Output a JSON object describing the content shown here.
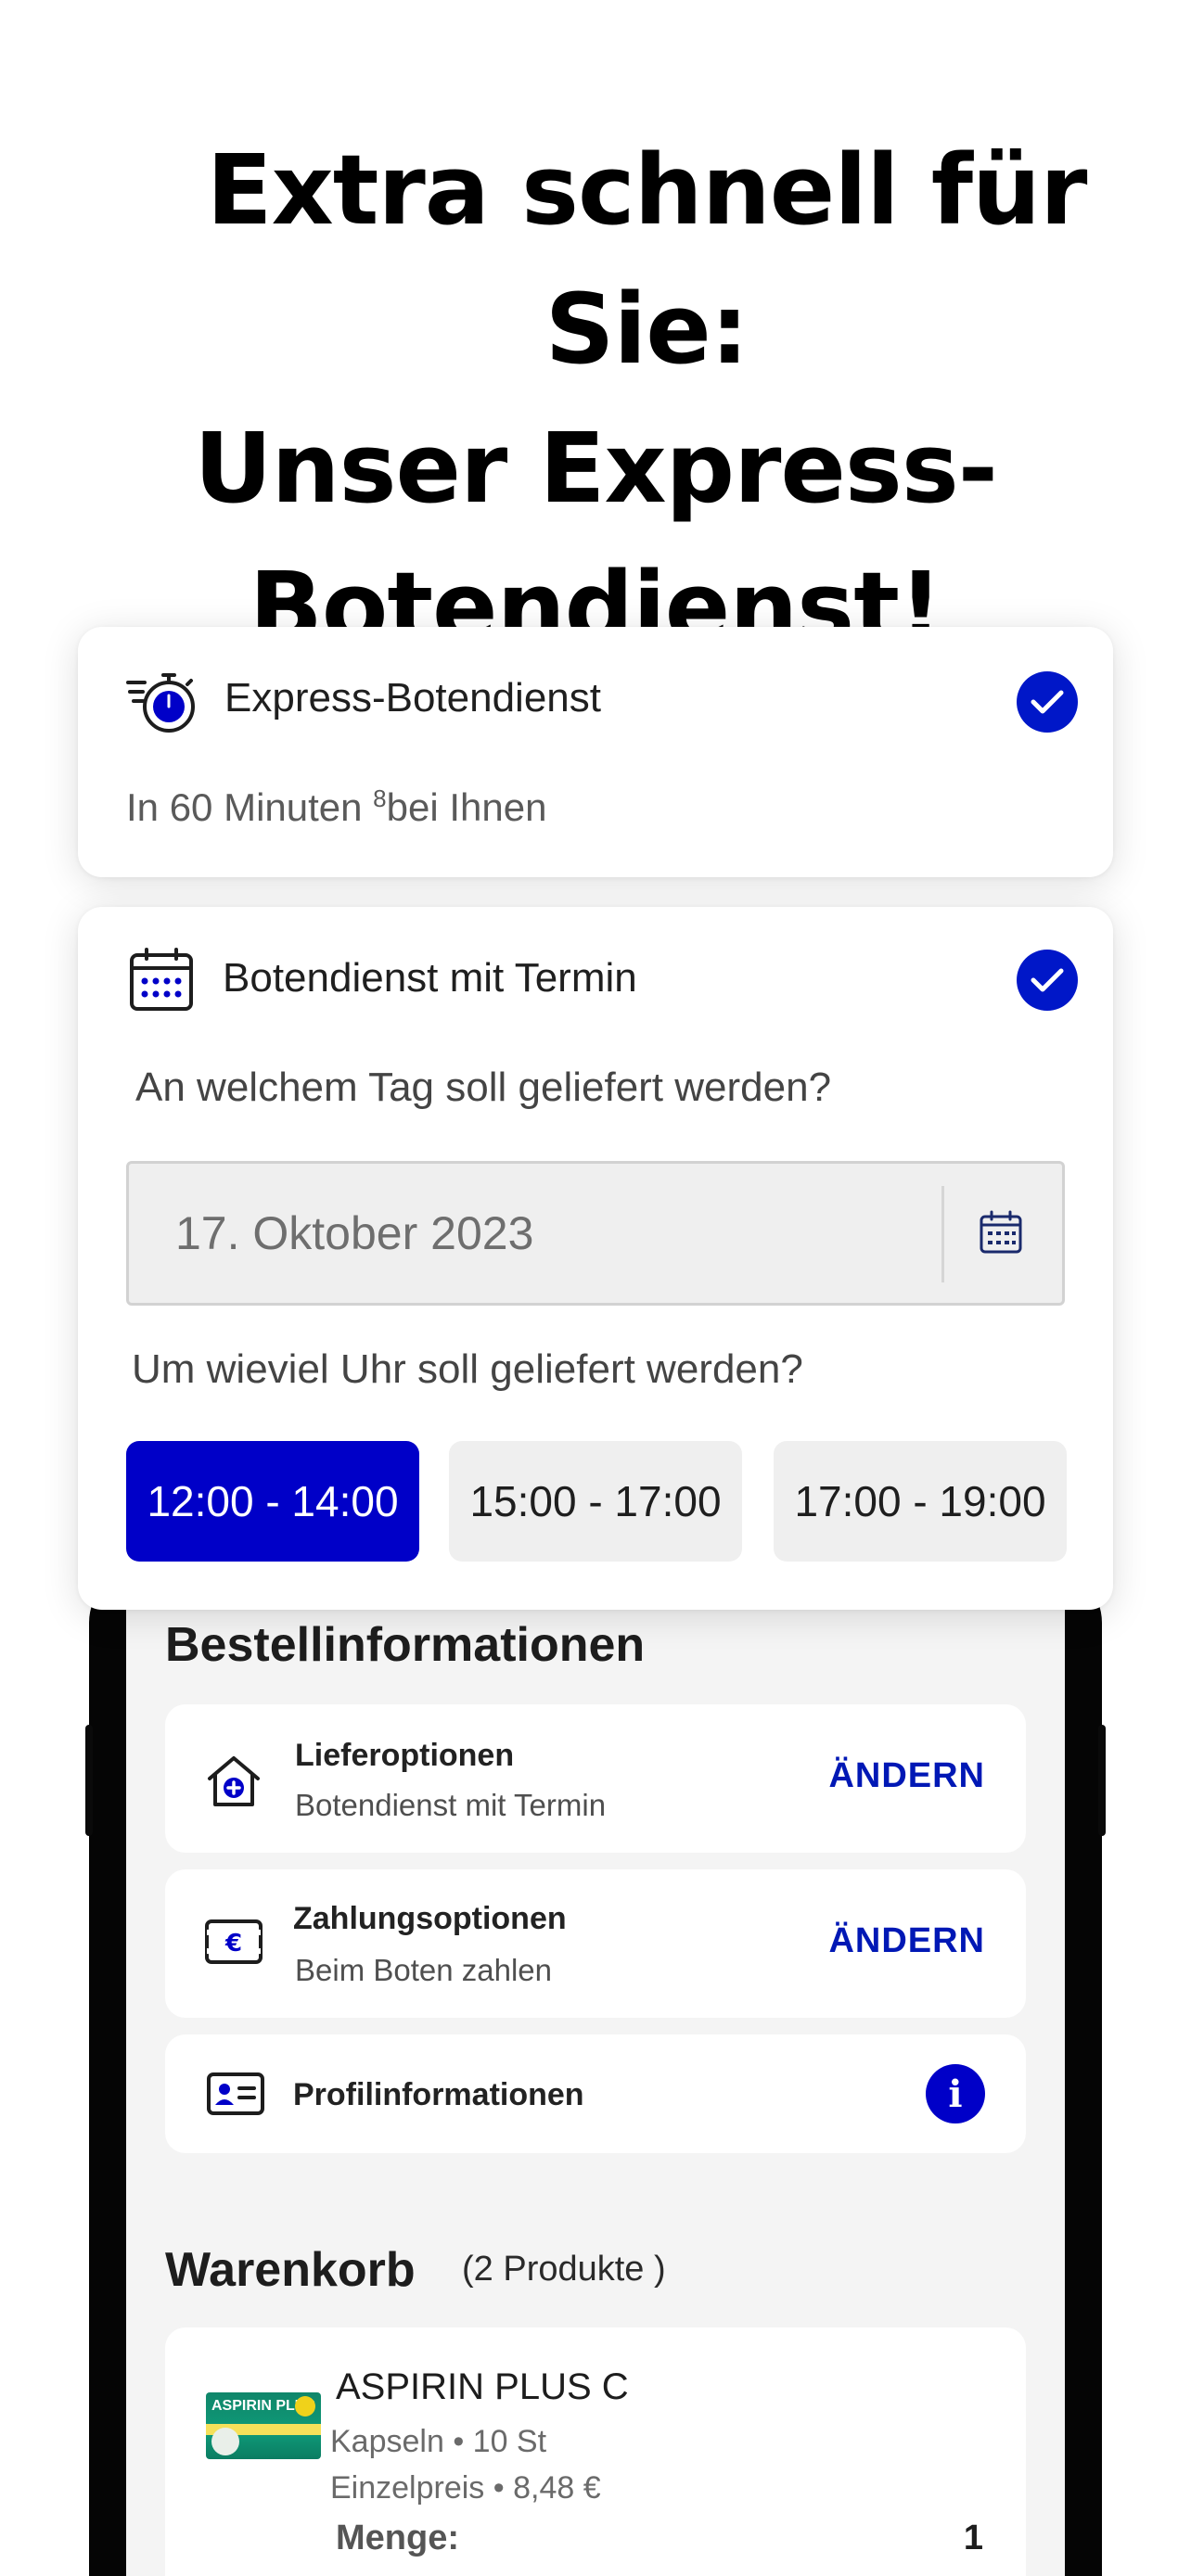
{
  "headline": {
    "line1": "Extra schnell für Sie:",
    "line2": "Unser Express-",
    "line3": "Botendienst!"
  },
  "express": {
    "title": "Express-Botendienst",
    "subtitle_prefix": "In 60 Minuten ",
    "subtitle_sup": "8",
    "subtitle_suffix": "bei Ihnen",
    "selected": true
  },
  "termin": {
    "title": "Botendienst mit Termin",
    "selected": true,
    "day_question": "An welchem Tag soll geliefert werden?",
    "date_value": "17. Oktober 2023",
    "time_question": "Um wieviel Uhr soll geliefert werden?",
    "slots": [
      "12:00 - 14:00",
      "15:00 - 17:00",
      "17:00 - 19:00"
    ],
    "active_slot": "12:00 - 14:00"
  },
  "order_info": {
    "title": "Bestellinformationen",
    "delivery": {
      "label": "Lieferoptionen",
      "value": "Botendienst mit Termin",
      "action": "ÄNDERN"
    },
    "payment": {
      "label": "Zahlungsoptionen",
      "value": "Beim Boten zahlen",
      "action": "ÄNDERN"
    },
    "profile": {
      "label": "Profilinformationen",
      "info_icon": "i"
    }
  },
  "cart": {
    "title": "Warenkorb",
    "count": "(2 Produkte )",
    "items": [
      {
        "name": "ASPIRIN PLUS C",
        "form": "Kapseln • 10 St",
        "unit_price": "Einzelpreis • 8,48 €",
        "qty_label": "Menge:",
        "qty": "1",
        "image_brand": "ASPIRIN PLUS"
      }
    ]
  },
  "colors": {
    "accent": "#0000c8",
    "link": "#0018b5",
    "check": "#0017c8"
  }
}
